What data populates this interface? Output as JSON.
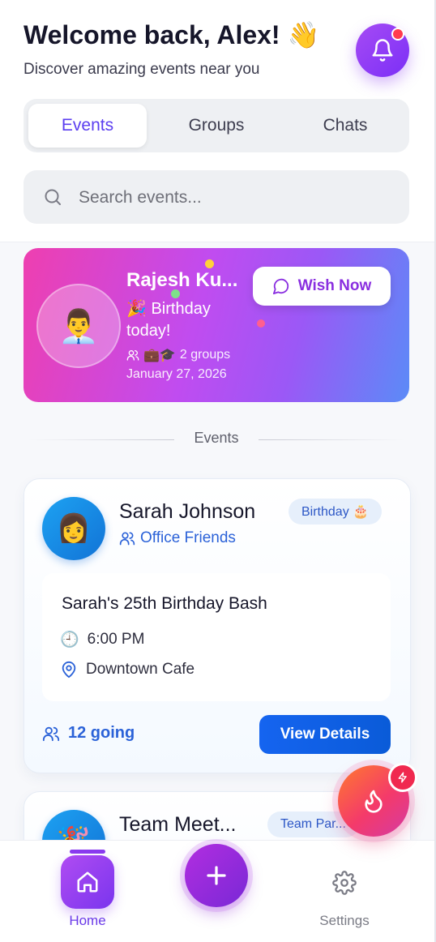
{
  "header": {
    "welcome": "Welcome back, Alex! 👋",
    "subtitle": "Discover amazing events near you",
    "notification_icon": "bell-icon",
    "has_notification_dot": true
  },
  "tabs": [
    {
      "label": "Events",
      "active": true
    },
    {
      "label": "Groups",
      "active": false
    },
    {
      "label": "Chats",
      "active": false
    }
  ],
  "search": {
    "placeholder": "Search events...",
    "value": ""
  },
  "birthday_card": {
    "name": "Rajesh Ku...",
    "avatar_emoji": "👨‍💼",
    "message": "🎉 Birthday today!",
    "group_emojis": "💼🎓",
    "groups": "2 groups",
    "date": "January 27, 2026",
    "action": "Wish Now"
  },
  "section_label": "Events",
  "events": [
    {
      "host": "Sarah Johnson",
      "avatar_emoji": "👩",
      "group": "Office Friends",
      "badge": "Birthday 🎂",
      "title": "Sarah's 25th Birthday Bash",
      "time_icon": "🕘",
      "time": "6:00 PM",
      "location": "Downtown Cafe",
      "going": "12 going",
      "action": "View Details"
    },
    {
      "host": "Team Meet...",
      "avatar_emoji": "🎉",
      "badge": "Team Par..."
    }
  ],
  "bottom_nav": {
    "home": "Home",
    "add": "+",
    "settings": "Settings"
  },
  "fab": {
    "icon": "flame-icon",
    "badge_icon": "bolt-icon"
  },
  "colors": {
    "accent": "#5b3ef0",
    "primary_blue": "#1564f0",
    "purple": "#8a3bef",
    "notification_red": "#ff3b4e"
  }
}
